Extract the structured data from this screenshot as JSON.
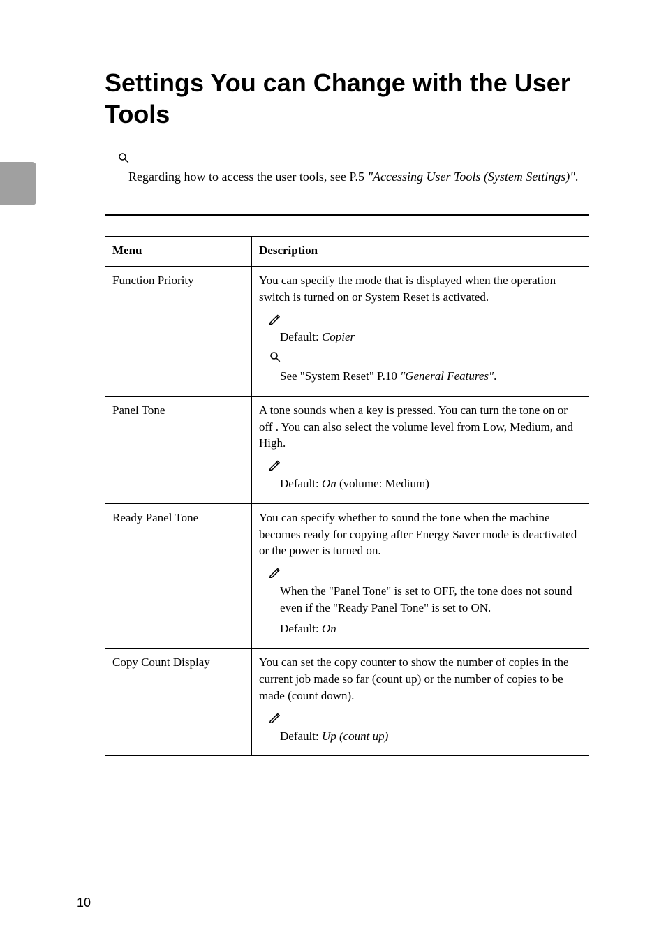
{
  "title": "Settings You can Change with the User Tools",
  "reference": {
    "text_before": "Regarding how to access the user tools, see ",
    "page_ref": "P.5 ",
    "italic": "\"Accessing User Tools (System Settings)\"",
    "after": "."
  },
  "table": {
    "headers": [
      "Menu",
      "Description"
    ],
    "rows": [
      {
        "menu": "Function Priority",
        "desc_main": "You can specify the mode that is displayed when the operation switch is turned on or System Reset is activated.",
        "note_lines": [
          "Default: ",
          "Copier"
        ],
        "ref_before": "See \"System Reset\" ",
        "ref_page": "P.10 ",
        "ref_italic": "\"General Features\"",
        "ref_after": "."
      },
      {
        "menu": "Panel Tone",
        "desc_main": "A tone sounds when a key is pressed. You can turn the tone on or off . You can also select the volume level from Low, Medium, and High.",
        "note_before": "Default: ",
        "note_italic": "On",
        "note_after": " (volume: Medium)"
      },
      {
        "menu": "Ready Panel Tone",
        "desc_main": "You can specify whether to sound the tone when the machine becomes ready for copying after Energy Saver mode is deactivated or the power is turned on.",
        "note_para": "When the \"Panel Tone\" is set to OFF, the tone does not sound even if the \"Ready Panel Tone\" is set to ON.",
        "note_default_before": "Default: ",
        "note_default_italic": "On"
      },
      {
        "menu": "Copy Count Display",
        "desc_main": "You can set the copy counter to show the number of copies in the current job made so far (count up) or the number of copies to be made (count down).",
        "note_before": "Default: ",
        "note_italic": "Up (count up)"
      }
    ]
  },
  "page_number": "10"
}
